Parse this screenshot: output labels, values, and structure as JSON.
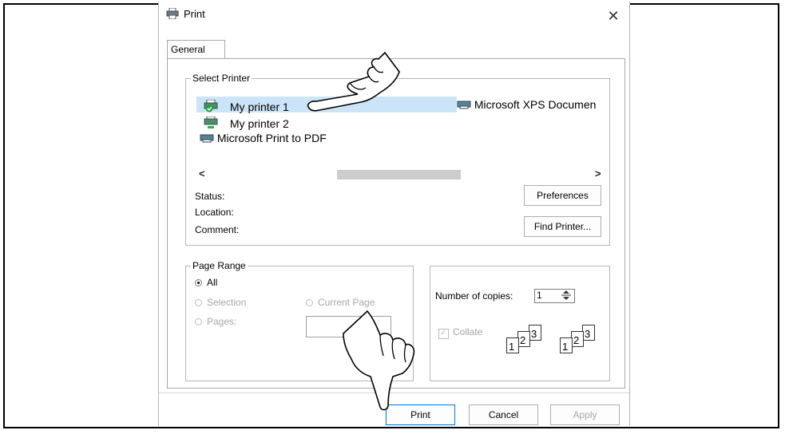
{
  "window": {
    "title": "Print",
    "close_glyph": "✕"
  },
  "tabs": [
    {
      "label": "General"
    }
  ],
  "select_printer": {
    "legend": "Select Printer",
    "printers": [
      {
        "name": "My printer 1",
        "icon": "printer-default-icon",
        "selected": true
      },
      {
        "name": "My printer 2",
        "icon": "printer-network-icon",
        "selected": false
      },
      {
        "name": "Microsoft Print to PDF",
        "icon": "printer-icon",
        "selected": false
      },
      {
        "name": "Microsoft XPS Documen",
        "icon": "printer-icon",
        "selected": false
      }
    ],
    "scroll_left": "<",
    "scroll_right": ">",
    "status_label": "Status:",
    "location_label": "Location:",
    "comment_label": "Comment:",
    "preferences_button": "Preferences",
    "find_printer_button": "Find Printer..."
  },
  "page_range": {
    "legend": "Page Range",
    "all_label": "All",
    "selection_label": "Selection",
    "current_page_label": "Current Page",
    "pages_label": "Pages:"
  },
  "copies": {
    "label": "Number of copies:",
    "value": "1",
    "collate_label": "Collate",
    "collate_glyph": "✓",
    "collate_numbers": [
      "1",
      "2",
      "3"
    ]
  },
  "buttons": {
    "print": "Print",
    "cancel": "Cancel",
    "apply": "Apply"
  },
  "colors": {
    "selection_highlight": "#cce4f7",
    "disabled_text": "#a7a7a7"
  }
}
